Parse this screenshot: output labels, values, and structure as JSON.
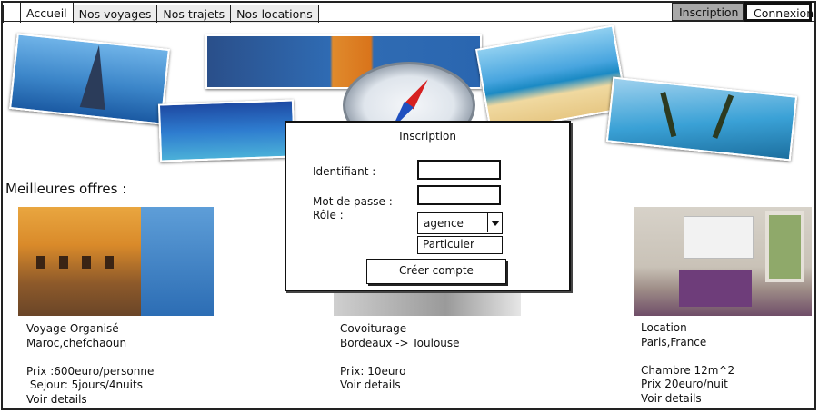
{
  "tabs": [
    "Accueil",
    "Nos voyages",
    "Nos trajets",
    "Nos locations"
  ],
  "header": {
    "inscription_label": "Inscription",
    "connexion_label": "Connexion"
  },
  "offers_title": "Meilleures offres :",
  "offers": [
    {
      "line1": "Voyage Organisé",
      "line2": "Maroc,chefchaoun",
      "line3": "Prix :600euro/personne",
      "line4": " Sejour: 5jours/4nuits",
      "link": "Voir details"
    },
    {
      "line1": "Covoiturage",
      "line2": "Bordeaux -> Toulouse",
      "line3": "Prix: 10euro",
      "link": "Voir details"
    },
    {
      "line1": "Location",
      "line2": "Paris,France",
      "line3": "Chambre 12m^2",
      "line4": "Prix 20euro/nuit",
      "link": "Voir details"
    }
  ],
  "modal": {
    "title": "Inscription",
    "identifiant_label": "Identifiant :",
    "identifiant_value": "",
    "password_label": "Mot de passe :",
    "password_value": "",
    "role_label": "Rôle :",
    "role_selected": "agence",
    "role_option": "Particuier",
    "submit_label": "Créer compte"
  }
}
